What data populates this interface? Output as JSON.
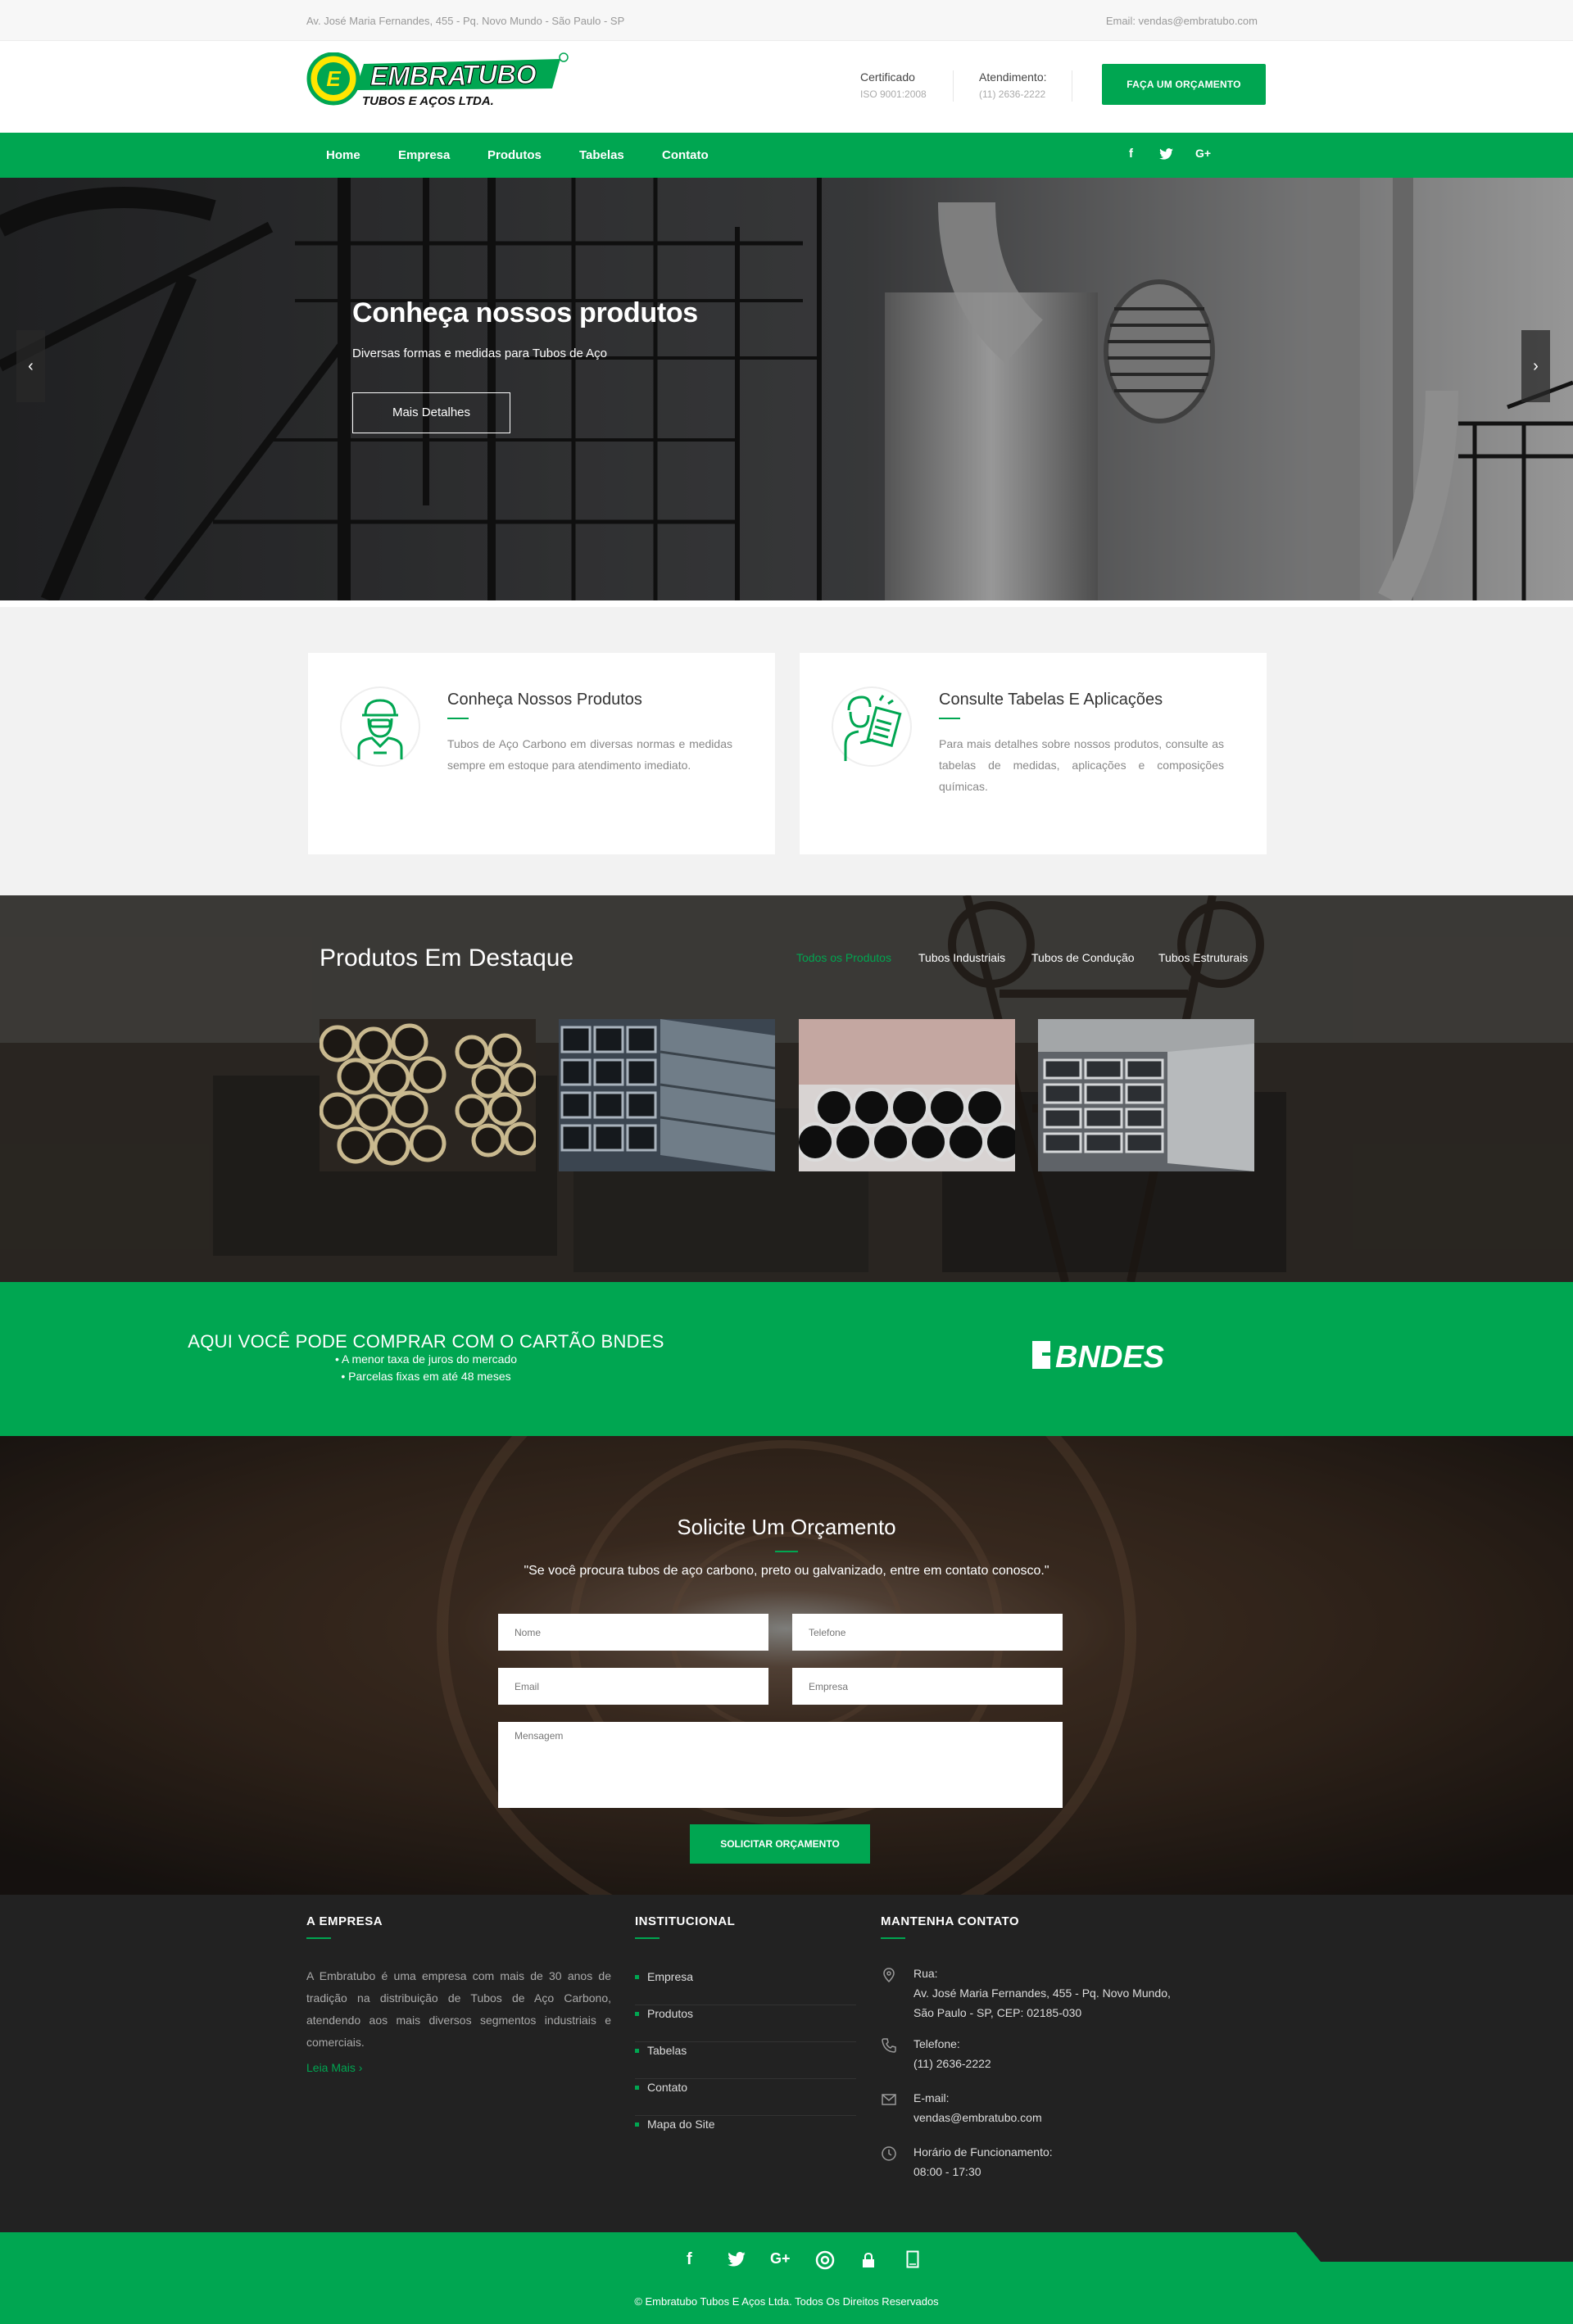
{
  "topbar": {
    "address": "Av. José Maria Fernandes, 455 - Pq. Novo Mundo - São Paulo - SP",
    "email": "Email: vendas@embratubo.com"
  },
  "header": {
    "logo": {
      "word_left": "EMBRA",
      "word_right": "TUBO",
      "tagline": "TUBOS E AÇOS LTDA.",
      "emblem": "E"
    },
    "certificado_label": "Certificado",
    "certificado_value": "ISO 9001:2008",
    "atendimento_label": "Atendimento:",
    "atendimento_value": "(11) 2636-2222",
    "quote_button": "FAÇA UM ORÇAMENTO"
  },
  "nav": {
    "items": [
      "Home",
      "Empresa",
      "Produtos",
      "Tabelas",
      "Contato"
    ],
    "social": [
      "facebook-icon",
      "twitter-icon",
      "google-plus-icon"
    ]
  },
  "hero": {
    "title": "Conheça nossos produtos",
    "subtitle": "Diversas formas e medidas para Tubos de Aço",
    "button": "Mais Detalhes",
    "prev": "‹",
    "next": "›"
  },
  "features": [
    {
      "icon": "worker-icon",
      "title": "Conheça Nossos Produtos",
      "text": "Tubos de Aço Carbono em diversas normas e medidas sempre em estoque para atendimento imediato."
    },
    {
      "icon": "clipboard-person-icon",
      "title": "Consulte Tabelas E Aplicações",
      "text": "Para mais detalhes sobre nossos produtos, consulte as tabelas de medidas, aplicações e composições químicas."
    }
  ],
  "products": {
    "title": "Produtos Em Destaque",
    "filters": [
      "Todos os Produtos",
      "Tubos Industriais",
      "Tubos de Condução",
      "Tubos Estruturais"
    ],
    "active_filter": "Todos os Produtos",
    "items": [
      "round-steel-tubes-photo",
      "square-steel-tubes-photo",
      "galvanized-tubes-photo",
      "rectangular-tubes-photo"
    ]
  },
  "bndes": {
    "title": "AQUI VOCÊ PODE COMPRAR COM O CARTÃO BNDES",
    "line1": "• A menor taxa de juros do mercado",
    "line2": "• Parcelas fixas em até 48 meses",
    "logo_text": "BNDES"
  },
  "contact": {
    "title": "Solicite Um Orçamento",
    "quote": "\"Se você procura tubos de aço carbono, preto ou galvanizado, entre em contato conosco.\"",
    "fields": {
      "nome": "Nome",
      "telefone": "Telefone",
      "email": "Email",
      "empresa": "Empresa",
      "mensagem": "Mensagem"
    },
    "button": "SOLICITAR ORÇAMENTO"
  },
  "footer": {
    "about_title": "A EMPRESA",
    "about_text": "A Embratubo é uma empresa com mais de 30 anos de tradição na distribuição de Tubos de Aço Carbono, atendendo aos mais diversos segmentos industriais e comerciais.",
    "about_more": "Leia Mais  ›",
    "inst_title": "INSTITUCIONAL",
    "inst_links": [
      "Empresa",
      "Produtos",
      "Tabelas",
      "Contato",
      "Mapa do Site"
    ],
    "contact_title": "MANTENHA CONTATO",
    "rua_label": "Rua:",
    "rua_line1": "Av. José Maria Fernandes, 455 - Pq. Novo Mundo,",
    "rua_line2": "São Paulo - SP, CEP: 02185-030",
    "tel_label": "Telefone:",
    "tel_value": "(11) 2636-2222",
    "email_label": "E-mail:",
    "email_value": "vendas@embratubo.com",
    "hours_label": "Horário de Funcionamento:",
    "hours_value": "08:00 - 17:30"
  },
  "bottom": {
    "icons": [
      "facebook-icon",
      "twitter-icon",
      "google-plus-icon",
      "dribbble-icon",
      "lock-icon",
      "tablet-icon"
    ],
    "copyright": "© Embratubo Tubos E Aços Ltda. Todos Os Direitos Reservados"
  },
  "colors": {
    "brand_green": "#00a651",
    "footer_dark": "#222222",
    "logo_yellow": "#ffe600"
  }
}
